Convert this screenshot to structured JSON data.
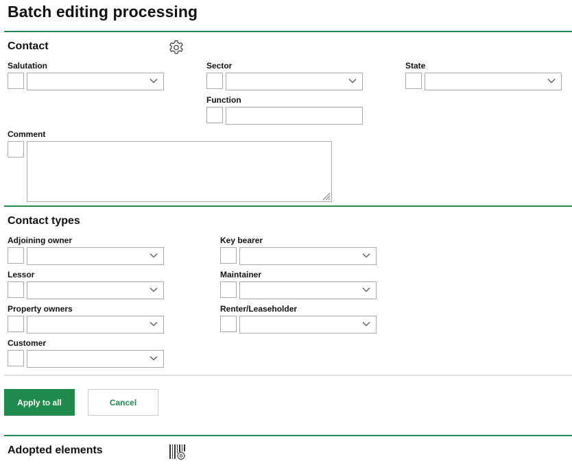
{
  "page": {
    "title": "Batch editing processing"
  },
  "contact": {
    "title": "Contact",
    "icons": {
      "settings": "gear-icon"
    },
    "fields": {
      "salutation": {
        "label": "Salutation",
        "value": ""
      },
      "sector": {
        "label": "Sector",
        "value": ""
      },
      "state": {
        "label": "State",
        "value": ""
      },
      "function": {
        "label": "Function",
        "value": ""
      },
      "comment": {
        "label": "Comment",
        "value": ""
      }
    }
  },
  "contact_types": {
    "title": "Contact types",
    "fields": {
      "adjoining_owner": {
        "label": "Adjoining owner",
        "value": ""
      },
      "lessor": {
        "label": "Lessor",
        "value": ""
      },
      "property_owners": {
        "label": "Property owners",
        "value": ""
      },
      "customer": {
        "label": "Customer",
        "value": ""
      },
      "key_bearer": {
        "label": "Key bearer",
        "value": ""
      },
      "maintainer": {
        "label": "Maintainer",
        "value": ""
      },
      "renter_leaseholder": {
        "label": "Renter/Leaseholder",
        "value": ""
      }
    }
  },
  "actions": {
    "apply_label": "Apply to all",
    "cancel_label": "Cancel"
  },
  "adopted": {
    "title": "Adopted elements",
    "icons": {
      "configure": "barcode-gear-icon"
    }
  },
  "colors": {
    "accent": "#1e8a4c",
    "border": "#a8a8a8",
    "text": "#111111"
  }
}
